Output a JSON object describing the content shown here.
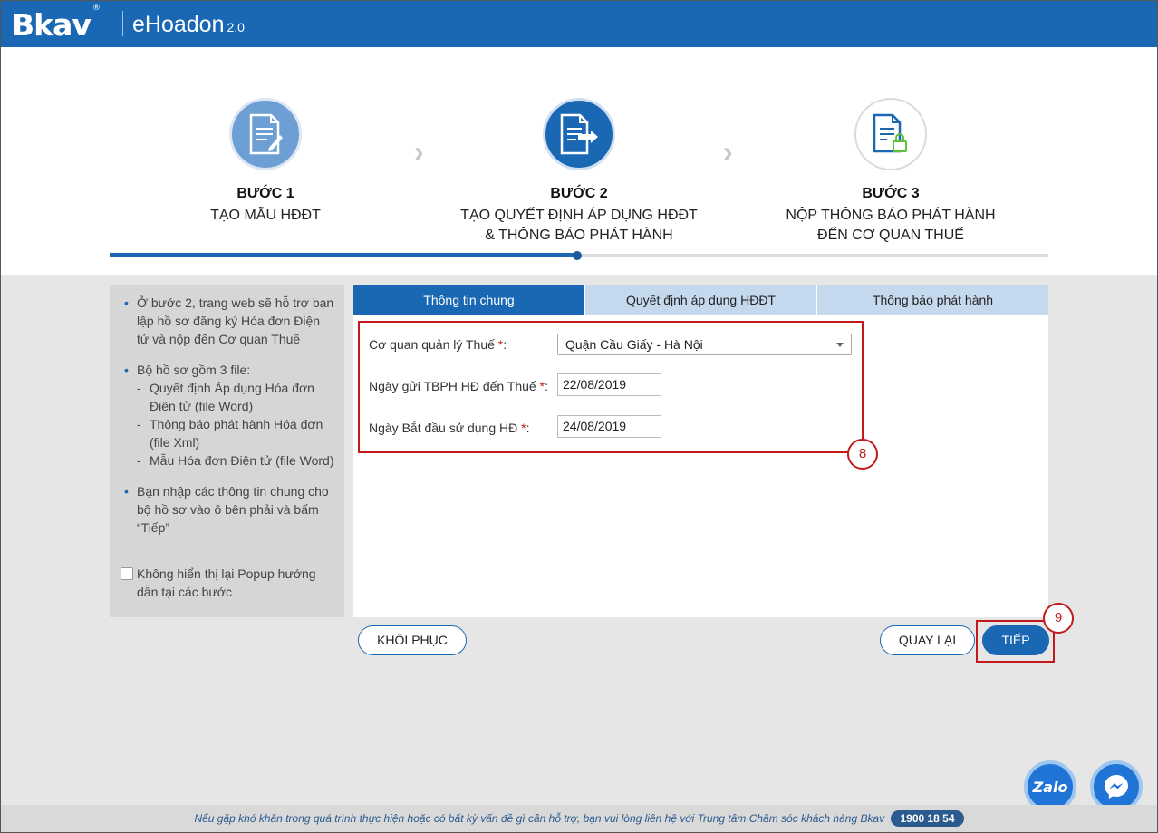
{
  "header": {
    "brand": "Bkav",
    "brand_mark": "®",
    "product": "eHoadon",
    "version": "2.0"
  },
  "steps": [
    {
      "title": "BƯỚC 1",
      "desc_line1": "TẠO MẪU HĐĐT",
      "desc_line2": "",
      "icon": "document-edit-icon"
    },
    {
      "title": "BƯỚC 2",
      "desc_line1": "TẠO QUYẾT ĐỊNH ÁP DỤNG HĐĐT",
      "desc_line2": "& THÔNG BÁO PHÁT HÀNH",
      "icon": "document-send-icon"
    },
    {
      "title": "BƯỚC 3",
      "desc_line1": "NỘP THÔNG BÁO PHÁT HÀNH",
      "desc_line2": "ĐẾN CƠ QUAN THUẾ",
      "icon": "document-lock-icon"
    }
  ],
  "progress": {
    "current_step": 2,
    "total_steps": 3
  },
  "guide": {
    "bullet1": "Ở bước 2, trang web sẽ hỗ trợ bạn lập hồ sơ đăng ký Hóa đơn Điện tử và nộp đến Cơ quan Thuế",
    "bullet2": "Bộ hồ sơ gồm 3 file:",
    "files": [
      "Quyết định Áp dụng Hóa đơn Điện tử (file Word)",
      "Thông báo phát hành Hóa đơn (file Xml)",
      "Mẫu Hóa đơn Điện tử (file Word)"
    ],
    "bullet3": "Bạn nhập các thông tin chung cho bộ hồ sơ vào ô bên phải và bấm “Tiếp”",
    "checkbox_label": "Không hiển thị lại Popup hướng dẫn tại các bước"
  },
  "tabs": [
    "Thông tin chung",
    "Quyết định áp dụng HĐĐT",
    "Thông báo phát hành"
  ],
  "form": {
    "tax_office_label": "Cơ quan quản lý Thuế",
    "tax_office_value": "Quận Cầu Giấy - Hà Nội",
    "send_date_label": "Ngày gửi TBPH HĐ đến Thuế",
    "send_date_value": "22/08/2019",
    "start_date_label": "Ngày Bắt đầu sử dụng HĐ",
    "start_date_value": "24/08/2019",
    "required_mark": "*",
    "colon": ":"
  },
  "annotations": {
    "badge_form": "8",
    "badge_next": "9"
  },
  "buttons": {
    "restore": "KHÔI PHỤC",
    "back": "QUAY LẠI",
    "next": "TIẾP"
  },
  "chat": {
    "zalo": "Zalo"
  },
  "footer": {
    "text": "Nếu gặp khó khăn trong quá trình thực hiện hoặc có bất kỳ vấn đề gì cần hỗ trợ, bạn vui lòng liên hệ với Trung tâm Chăm sóc khách hàng Bkav",
    "phone": "1900 18 54"
  },
  "colors": {
    "primary": "#1a68b3",
    "annotation_red": "#c11a1a",
    "tab_inactive": "#c5d9ee"
  }
}
